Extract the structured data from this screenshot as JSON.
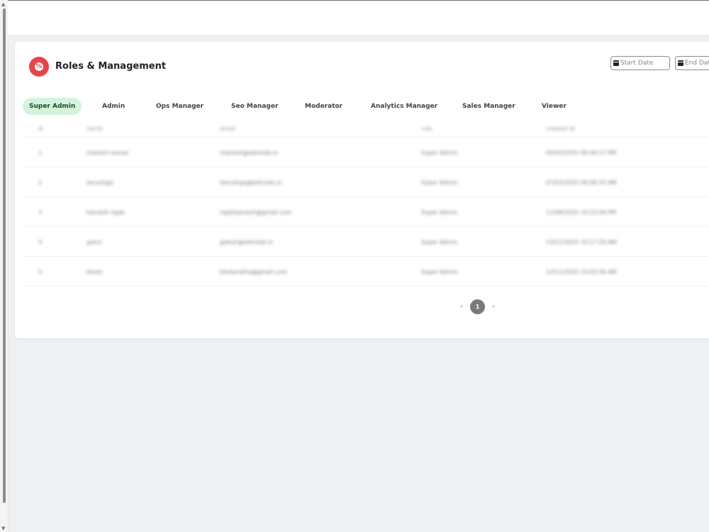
{
  "header": {
    "title": "Roles & Management",
    "start_date_placeholder": "Start Date",
    "end_date_placeholder": "End Date"
  },
  "tabs": [
    {
      "label": "Super Admin",
      "active": true
    },
    {
      "label": "Admin"
    },
    {
      "label": "Ops Manager"
    },
    {
      "label": "Seo Manager"
    },
    {
      "label": "Moderator"
    },
    {
      "label": "Analytics Manager"
    },
    {
      "label": "Sales Manager"
    },
    {
      "label": "Viewer"
    }
  ],
  "table": {
    "columns": [
      "#",
      "name",
      "email",
      "role",
      "created at"
    ],
    "rows": [
      [
        "1",
        "mahesh kumar",
        "mahesh@edmodo.in",
        "Super Admin",
        "05/03/2025 06:40:27 PM"
      ],
      [
        "2",
        "tanushga",
        "tanushga@edmodo.in",
        "Super Admin",
        "07/03/2025 09:08:33 AM"
      ],
      [
        "3",
        "kamesh rajak",
        "rajakkamesh@gmail.com",
        "Super Admin",
        "11/08/2025 10:23:56 PM"
      ],
      [
        "4",
        "gokul",
        "gokulr@edmodo.in",
        "Super Admin",
        "13/11/2025 10:17:29 AM"
      ],
      [
        "5",
        "bhola",
        "bholanathe@gmail.com",
        "Super Admin",
        "13/11/2025 10:03:56 AM"
      ]
    ]
  },
  "pagination": {
    "prev": "«",
    "current": "1",
    "next": "»"
  },
  "colors": {
    "accent": "#e64549",
    "active_tab_bg": "#d3f3dd",
    "page_bg": "#edf1f4"
  },
  "icons": {
    "brand": "role-badge-icon",
    "date": "calendar-icon"
  }
}
